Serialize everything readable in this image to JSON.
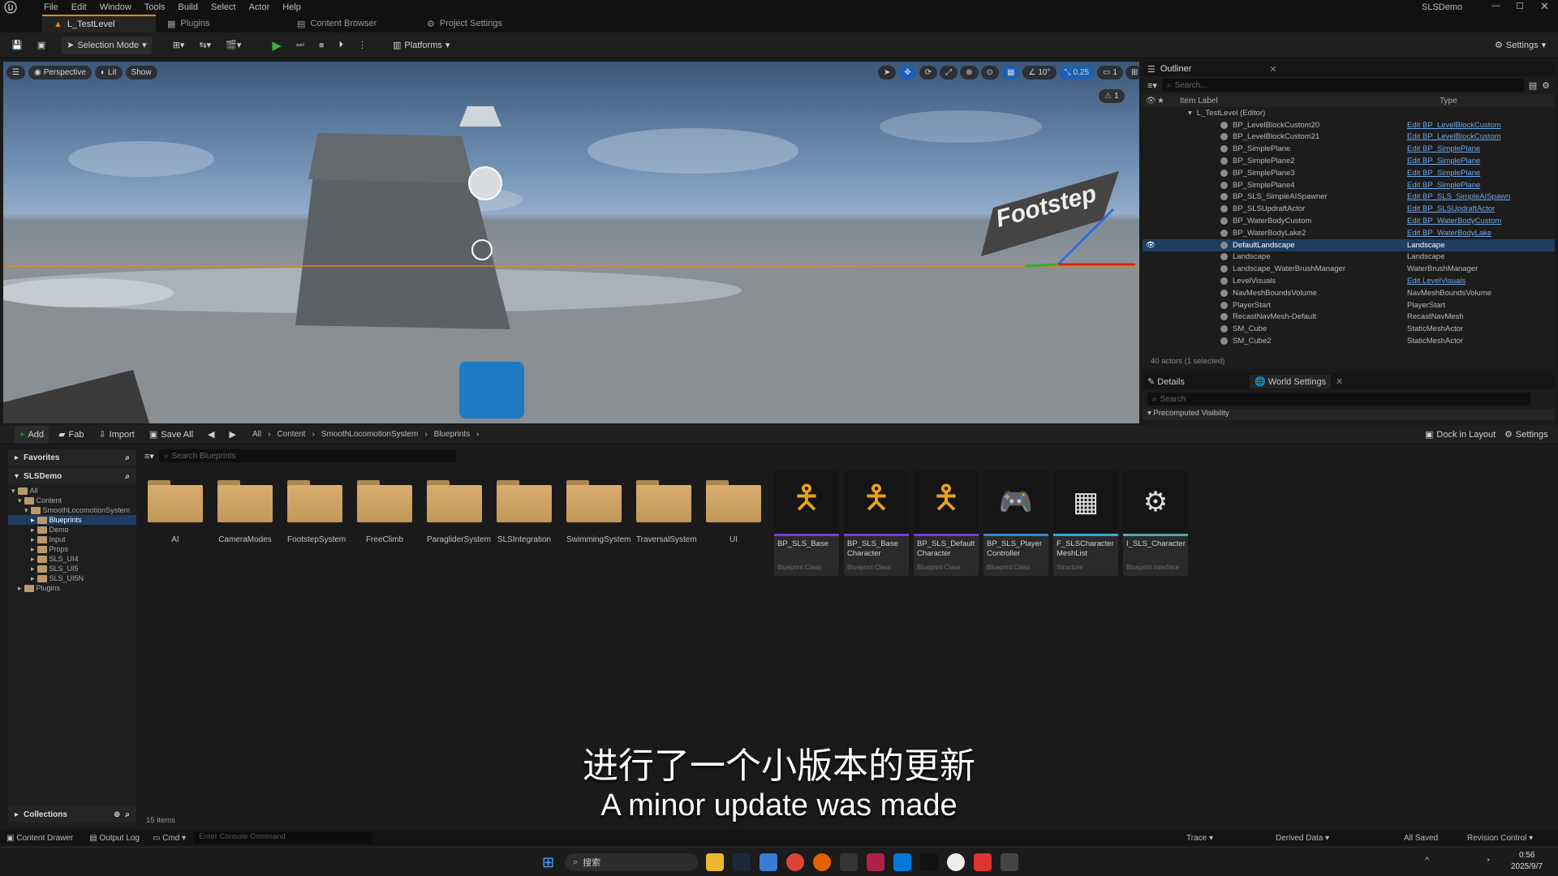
{
  "menu": [
    "File",
    "Edit",
    "Window",
    "Tools",
    "Build",
    "Select",
    "Actor",
    "Help"
  ],
  "project_name": "SLSDemo",
  "tabs": [
    "L_TestLevel",
    "Plugins",
    "Content Browser",
    "Project Settings"
  ],
  "toolbar": {
    "selection_mode": "Selection Mode",
    "platforms": "Platforms",
    "settings": "Settings"
  },
  "viewport": {
    "perspective": "Perspective",
    "lit": "Lit",
    "show": "Show",
    "snap_angle": "10°",
    "snap_scale": "0.25",
    "camera_speed": "1",
    "warning_count": "1",
    "sign_text": "Footstep"
  },
  "outliner": {
    "title": "Outliner",
    "search_placeholder": "Search...",
    "col_label": "Item Label",
    "col_type": "Type",
    "root": "L_TestLevel (Editor)",
    "rows": [
      {
        "label": "BP_LevelBlockCustom20",
        "type": "Edit BP_LevelBlockCustom",
        "link": true
      },
      {
        "label": "BP_LevelBlockCustom21",
        "type": "Edit BP_LevelBlockCustom",
        "link": true
      },
      {
        "label": "BP_SimplePlane",
        "type": "Edit BP_SimplePlane",
        "link": true
      },
      {
        "label": "BP_SimplePlane2",
        "type": "Edit BP_SimplePlane",
        "link": true
      },
      {
        "label": "BP_SimplePlane3",
        "type": "Edit BP_SimplePlane",
        "link": true
      },
      {
        "label": "BP_SimplePlane4",
        "type": "Edit BP_SimplePlane",
        "link": true
      },
      {
        "label": "BP_SLS_SimpleAISpawner",
        "type": "Edit BP_SLS_SimpleAISpawn",
        "link": true
      },
      {
        "label": "BP_SLSUpdraftActor",
        "type": "Edit BP_SLSUpdraftActor",
        "link": true
      },
      {
        "label": "BP_WaterBodyCustom",
        "type": "Edit BP_WaterBodyCustom",
        "link": true
      },
      {
        "label": "BP_WaterBodyLake2",
        "type": "Edit BP_WaterBodyLake",
        "link": true
      },
      {
        "label": "DefaultLandscape",
        "type": "Landscape",
        "link": false,
        "selected": true
      },
      {
        "label": "Landscape",
        "type": "Landscape",
        "link": false
      },
      {
        "label": "Landscape_WaterBrushManager",
        "type": "WaterBrushManager",
        "link": false
      },
      {
        "label": "LevelVisuals",
        "type": "Edit LevelVisuals",
        "link": true
      },
      {
        "label": "NavMeshBoundsVolume",
        "type": "NavMeshBoundsVolume",
        "link": false
      },
      {
        "label": "PlayerStart",
        "type": "PlayerStart",
        "link": false
      },
      {
        "label": "RecastNavMesh-Default",
        "type": "RecastNavMesh",
        "link": false
      },
      {
        "label": "SM_Cube",
        "type": "StaticMeshActor",
        "link": false
      },
      {
        "label": "SM_Cube2",
        "type": "StaticMeshActor",
        "link": false
      }
    ],
    "footer": "40 actors (1 selected)"
  },
  "details": {
    "tab_details": "Details",
    "tab_world": "World Settings",
    "search_placeholder": "Search",
    "section": "Precomputed Visibility"
  },
  "content_browser": {
    "add": "Add",
    "fab": "Fab",
    "import": "Import",
    "save_all": "Save All",
    "breadcrumb": [
      "All",
      "Content",
      "SmoothLocomotionSystem",
      "Blueprints"
    ],
    "dock": "Dock in Layout",
    "settings": "Settings",
    "favorites": "Favorites",
    "project": "SLSDemo",
    "tree": [
      "All",
      "Content",
      "SmoothLocomotionSystem",
      "Blueprints",
      "Demo",
      "Input",
      "Props",
      "SLS_UI4",
      "SLS_UI5",
      "SLS_UI5N",
      "Plugins"
    ],
    "search_placeholder": "Search Blueprints",
    "folders": [
      "AI",
      "CameraModes",
      "FootstepSystem",
      "FreeClimb",
      "ParagliderSystem",
      "SLSIntegration",
      "SwimmingSystem",
      "TraversalSystem",
      "UI"
    ],
    "assets": [
      {
        "name": "BP_SLS_Base",
        "cls": "Blueprint Class"
      },
      {
        "name": "BP_SLS_Base Character",
        "cls": "Blueprint Class"
      },
      {
        "name": "BP_SLS_Default Character",
        "cls": "Blueprint Class"
      },
      {
        "name": "BP_SLS_Player Controller",
        "cls": "Blueprint Class"
      },
      {
        "name": "F_SLSCharacter MeshList",
        "cls": "Structure"
      },
      {
        "name": "I_SLS_Character",
        "cls": "Blueprint Interface"
      }
    ],
    "item_count": "15 items",
    "collections": "Collections"
  },
  "subtitle": {
    "zh": "进行了一个小版本的更新",
    "en": "A minor update was made"
  },
  "statusbar": {
    "content_drawer": "Content Drawer",
    "output_log": "Output Log",
    "cmd": "Cmd",
    "console_placeholder": "Enter Console Command",
    "trace": "Trace",
    "derived_data": "Derived Data",
    "all_saved": "All Saved",
    "revision_control": "Revision Control"
  },
  "taskbar": {
    "search": "搜索",
    "time": "0:56",
    "date": "2025/9/7"
  },
  "colors": {
    "accent": "#e08a1a",
    "selection": "#1e3d63",
    "link": "#6fa6e6",
    "folder": "#c9a063",
    "play": "#3cb043"
  }
}
